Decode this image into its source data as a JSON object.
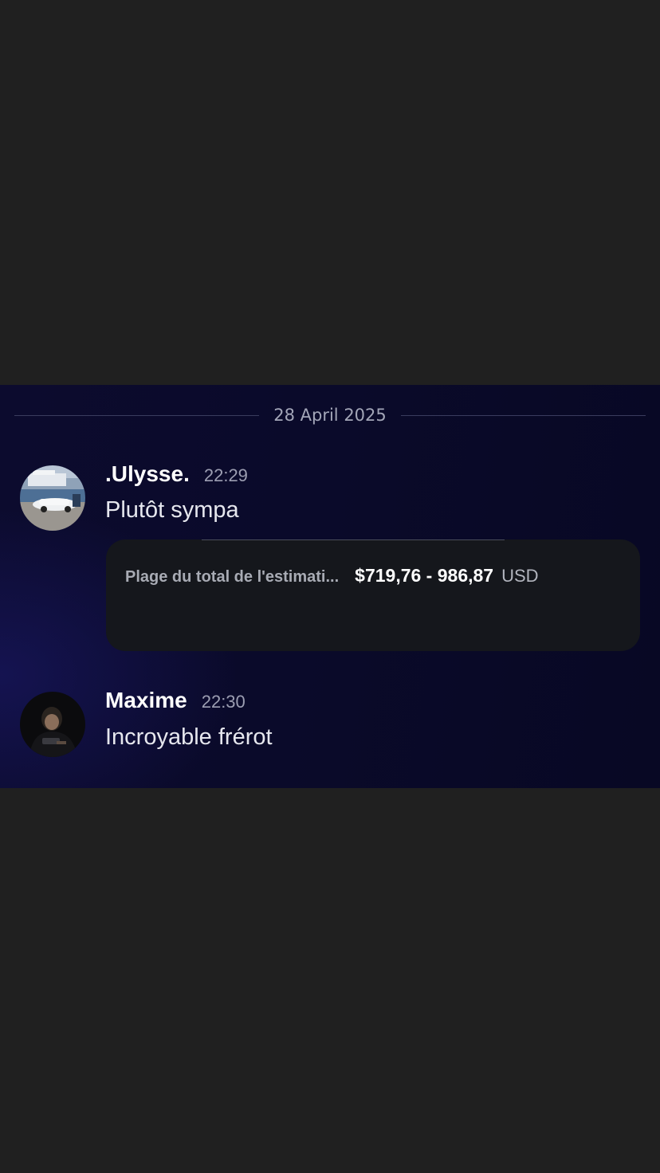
{
  "date_divider": "28 April 2025",
  "messages": [
    {
      "author": ".Ulysse.",
      "time": "22:29",
      "text": "Plutôt sympa",
      "embed": {
        "label": "Plage du total de l'estimati...",
        "value": "$719,76 - 986,87",
        "currency": "USD"
      }
    },
    {
      "author": "Maxime",
      "time": "22:30",
      "text": "Incroyable frérot"
    }
  ],
  "colors": {
    "page_background": "#202020",
    "chat_background": "#0c0b2e",
    "embed_background": "#15171c",
    "author_text": "#ffffff",
    "timestamp_text": "#9c9eb2"
  }
}
